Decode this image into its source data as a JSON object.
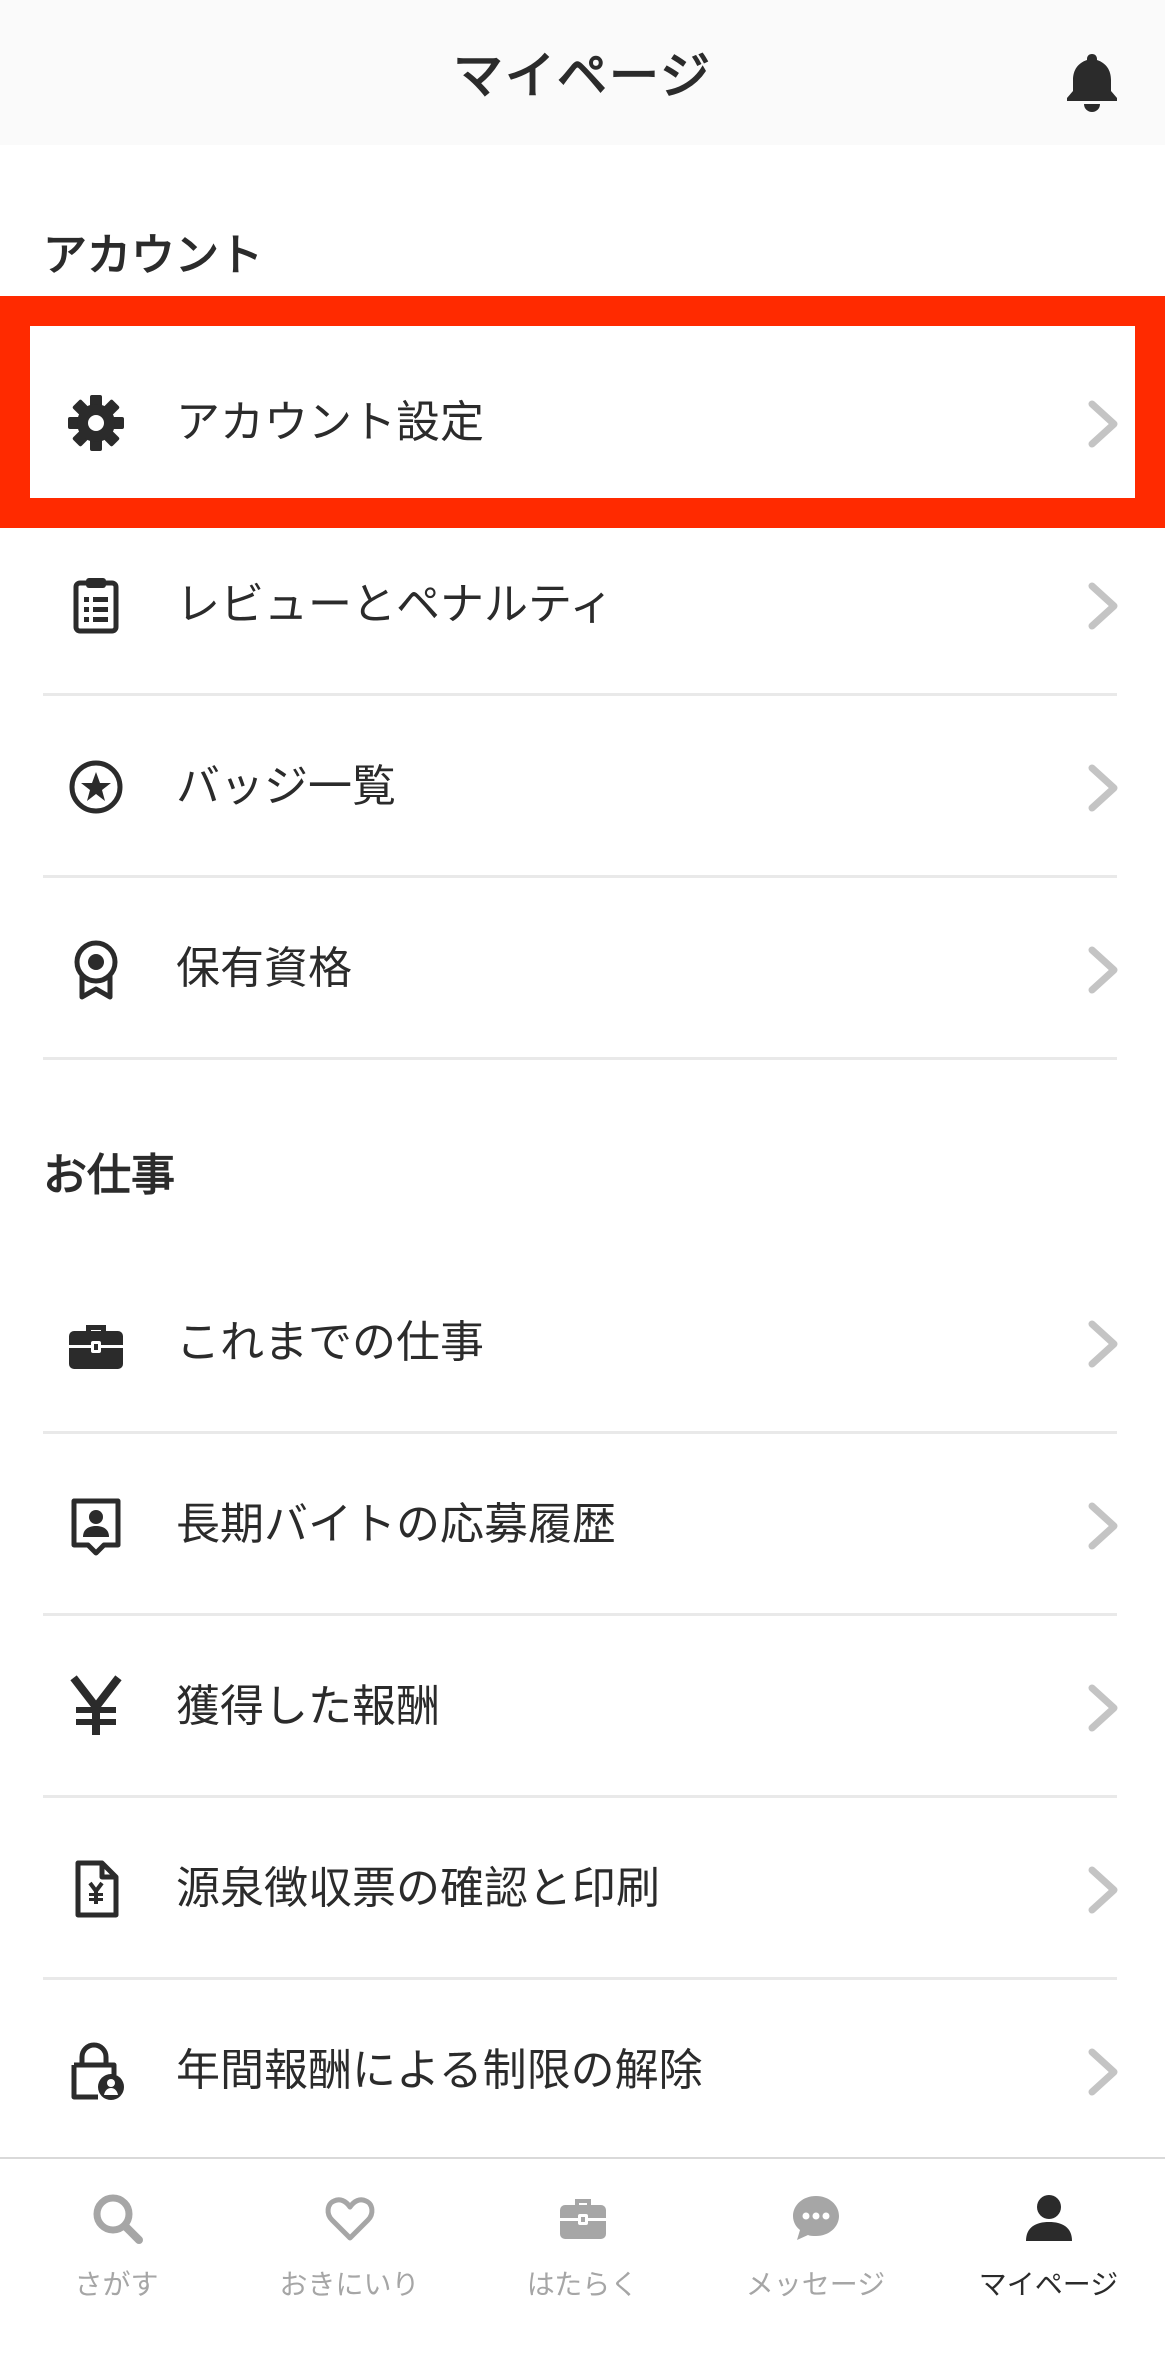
{
  "header": {
    "title": "マイページ",
    "bell_icon": "bell-icon"
  },
  "sections": {
    "account": {
      "title": "アカウント",
      "items": [
        {
          "label": "アカウント設定",
          "icon": "gear-icon",
          "highlighted": true
        },
        {
          "label": "レビューとペナルティ",
          "icon": "clipboard-icon"
        },
        {
          "label": "バッジ一覧",
          "icon": "star-badge-icon"
        },
        {
          "label": "保有資格",
          "icon": "certificate-icon"
        }
      ]
    },
    "work": {
      "title": "お仕事",
      "items": [
        {
          "label": "これまでの仕事",
          "icon": "briefcase-icon"
        },
        {
          "label": "長期バイトの応募履歴",
          "icon": "profile-card-icon"
        },
        {
          "label": "獲得した報酬",
          "icon": "yen-icon"
        },
        {
          "label": "源泉徴収票の確認と印刷",
          "icon": "yen-document-icon"
        },
        {
          "label": "年間報酬による制限の解除",
          "icon": "lock-user-icon"
        }
      ]
    }
  },
  "tabbar": {
    "tabs": [
      {
        "label": "さがす",
        "icon": "search-icon",
        "active": false
      },
      {
        "label": "おきにいり",
        "icon": "heart-icon",
        "active": false
      },
      {
        "label": "はたらく",
        "icon": "briefcase-icon",
        "active": false
      },
      {
        "label": "メッセージ",
        "icon": "chat-bubble-icon",
        "active": false
      },
      {
        "label": "マイページ",
        "icon": "person-icon",
        "active": true
      }
    ]
  },
  "colors": {
    "highlight": "#ff2a00",
    "text": "#2b2b2b",
    "inactive": "#a6a6a6",
    "chevron": "#c4c4c4"
  }
}
